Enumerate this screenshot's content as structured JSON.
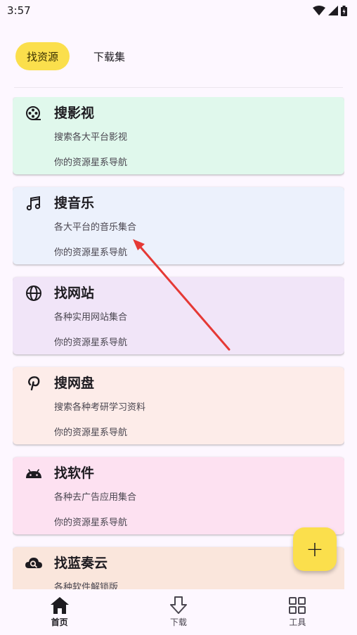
{
  "status_bar": {
    "time": "3:57"
  },
  "tabs": [
    {
      "label": "找资源",
      "active": true
    },
    {
      "label": "下载集",
      "active": false
    }
  ],
  "cards": [
    {
      "title": "搜影视",
      "desc": "搜索各大平台影视",
      "sub": "你的资源星系导航",
      "icon": "film-reel-icon",
      "color": "#e0f8ec"
    },
    {
      "title": "搜音乐",
      "desc": "各大平台的音乐集合",
      "sub": "你的资源星系导航",
      "icon": "music-note-icon",
      "color": "#ecf1fc"
    },
    {
      "title": "找网站",
      "desc": "各种实用网站集合",
      "sub": "你的资源星系导航",
      "icon": "globe-icon",
      "color": "#f1e5f8"
    },
    {
      "title": "搜网盘",
      "desc": "搜索各种考研学习资料",
      "sub": "你的资源星系导航",
      "icon": "pinterest-icon",
      "color": "#fdece9"
    },
    {
      "title": "找软件",
      "desc": "各种去广告应用集合",
      "sub": "你的资源星系导航",
      "icon": "android-icon",
      "color": "#fde1f1"
    },
    {
      "title": "找蓝奏云",
      "desc": "各种软件解锁版",
      "sub": "",
      "icon": "cloud-search-icon",
      "color": "#fae6dc"
    }
  ],
  "fab": {
    "label": "+"
  },
  "bottom_nav": [
    {
      "label": "首页",
      "icon": "home-icon",
      "active": true
    },
    {
      "label": "下载",
      "icon": "download-icon",
      "active": false
    },
    {
      "label": "工具",
      "icon": "grid-icon",
      "active": false
    }
  ],
  "colors": {
    "accent": "#fbdf4c",
    "background": "#fdf7ff",
    "annotation_arrow": "#e53935"
  }
}
